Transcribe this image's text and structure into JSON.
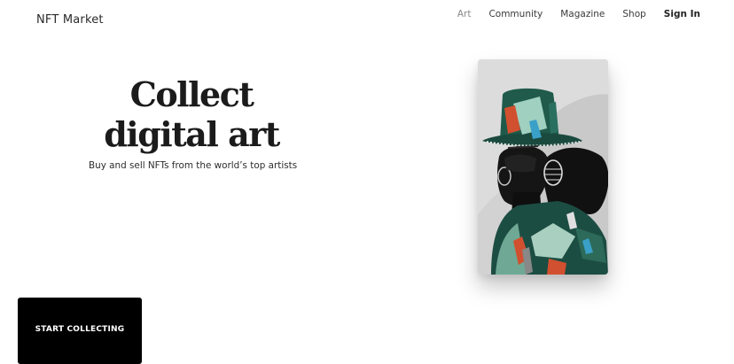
{
  "header": {
    "brand": "NFT Market",
    "nav": [
      {
        "label": "Art",
        "active": true
      },
      {
        "label": "Community",
        "active": false
      },
      {
        "label": "Magazine",
        "active": false
      },
      {
        "label": "Shop",
        "active": false
      },
      {
        "label": "Sign In",
        "active": false
      }
    ]
  },
  "hero": {
    "title_line1": "Collect",
    "title_line2": "digital art",
    "subtitle": "Buy and sell NFTs from the world’s top artists",
    "cta_label": "START COLLECTING"
  },
  "colors": {
    "cta_background": "#000000",
    "cta_text": "#ffffff",
    "art_background": "#d9d9d9",
    "art_hat": "#1f5a4a"
  }
}
